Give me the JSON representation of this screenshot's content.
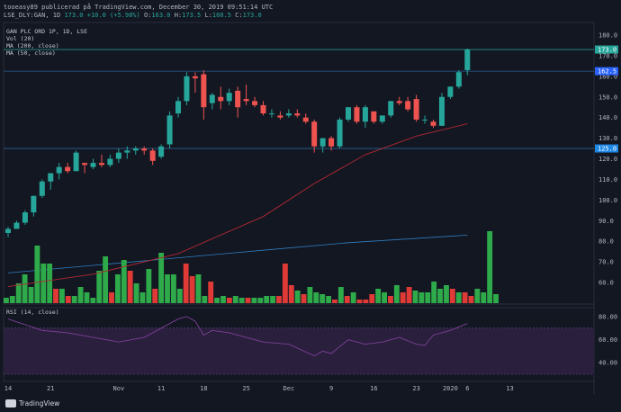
{
  "header": {
    "line1": "tooeasy89 publicerad på TradingView.com, December 30, 2019 09:51:14 UTC",
    "symbol": "LSE_DLY:GAN, 1D",
    "last": "173.0",
    "change": "+10.0 (+5.98%)",
    "o": "O:",
    "o_val": "163.0",
    "h": "H:",
    "h_val": "173.5",
    "l": "L:",
    "l_val": "160.5",
    "c": "C:",
    "c_val": "173.0"
  },
  "legend": {
    "title": "GAN PLC ORD 1P, 1D, LSE",
    "vol": "Vol (20)",
    "ma200": "MA (200, close)",
    "ma50": "MA (50, close)"
  },
  "rsi_label": "RSI (14, close)",
  "brand": "TradingView",
  "colors": {
    "bg": "#131722",
    "up": "#26a69a",
    "down": "#ef5350",
    "vol_up": "#2eaa4a",
    "vol_down": "#e03a36",
    "ma50": "#b22833",
    "ma200": "#2f7dc0",
    "rsi": "#7e3f98",
    "rsi_band": "#2a1f3d",
    "label_green": "#26a69a",
    "label_blue": "#2962ff",
    "label_blue2": "#1e88e5"
  },
  "chart_data": {
    "type": "candlestick",
    "y_ticks": [
      "180.0",
      "170.0",
      "160.0",
      "150.0",
      "140.0",
      "130.0",
      "120.0",
      "110.0",
      "100.0",
      "90.0",
      "80.0",
      "70.0",
      "60.0"
    ],
    "price_labels": [
      {
        "text": "173.0",
        "value": 173.0,
        "color": "green"
      },
      {
        "text": "162.5",
        "value": 162.5,
        "color": "blue"
      },
      {
        "text": "125.0",
        "value": 125.0,
        "color": "blue2"
      }
    ],
    "price_lines": [
      173.0,
      162.5,
      125.0
    ],
    "rsi_ticks": [
      "80.00",
      "60.00",
      "40.00"
    ],
    "rsi_band": [
      30,
      70
    ],
    "x_ticks": [
      {
        "label": "14",
        "idx": 0
      },
      {
        "label": "21",
        "idx": 5
      },
      {
        "label": "Nov",
        "idx": 13
      },
      {
        "label": "11",
        "idx": 18
      },
      {
        "label": "18",
        "idx": 23
      },
      {
        "label": "25",
        "idx": 28
      },
      {
        "label": "Dec",
        "idx": 33
      },
      {
        "label": "9",
        "idx": 38
      },
      {
        "label": "16",
        "idx": 43
      },
      {
        "label": "23",
        "idx": 48
      },
      {
        "label": "2020",
        "idx": 52
      },
      {
        "label": "6",
        "idx": 54
      },
      {
        "label": "13",
        "idx": 59
      }
    ],
    "candles": [
      {
        "o": 84,
        "h": 87,
        "l": 82,
        "c": 86
      },
      {
        "o": 86,
        "h": 90,
        "l": 86,
        "c": 89
      },
      {
        "o": 89,
        "h": 95,
        "l": 88,
        "c": 94
      },
      {
        "o": 94,
        "h": 102,
        "l": 92,
        "c": 102
      },
      {
        "o": 102,
        "h": 110,
        "l": 101,
        "c": 109
      },
      {
        "o": 109,
        "h": 113,
        "l": 105,
        "c": 113
      },
      {
        "o": 113,
        "h": 118,
        "l": 110,
        "c": 116
      },
      {
        "o": 116,
        "h": 118,
        "l": 113,
        "c": 114
      },
      {
        "o": 114,
        "h": 124,
        "l": 114,
        "c": 123
      },
      {
        "o": 118,
        "h": 118,
        "l": 113,
        "c": 117
      },
      {
        "o": 116,
        "h": 120,
        "l": 115,
        "c": 118
      },
      {
        "o": 118,
        "h": 122,
        "l": 116,
        "c": 117
      },
      {
        "o": 117,
        "h": 122,
        "l": 116,
        "c": 120
      },
      {
        "o": 120,
        "h": 125,
        "l": 118,
        "c": 123
      },
      {
        "o": 123,
        "h": 126,
        "l": 120,
        "c": 124
      },
      {
        "o": 124,
        "h": 126,
        "l": 122,
        "c": 125
      },
      {
        "o": 125,
        "h": 126,
        "l": 122,
        "c": 124
      },
      {
        "o": 124,
        "h": 125,
        "l": 117,
        "c": 119
      },
      {
        "o": 121,
        "h": 127,
        "l": 120,
        "c": 126
      },
      {
        "o": 127,
        "h": 143,
        "l": 125,
        "c": 141
      },
      {
        "o": 142,
        "h": 150,
        "l": 140,
        "c": 148
      },
      {
        "o": 148,
        "h": 162,
        "l": 146,
        "c": 160
      },
      {
        "o": 160,
        "h": 162,
        "l": 152,
        "c": 159
      },
      {
        "o": 161,
        "h": 163,
        "l": 139,
        "c": 145
      },
      {
        "o": 147,
        "h": 152,
        "l": 144,
        "c": 151
      },
      {
        "o": 150,
        "h": 155,
        "l": 144,
        "c": 148
      },
      {
        "o": 148,
        "h": 154,
        "l": 146,
        "c": 152
      },
      {
        "o": 153,
        "h": 155,
        "l": 140,
        "c": 145
      },
      {
        "o": 149,
        "h": 156,
        "l": 146,
        "c": 148
      },
      {
        "o": 148,
        "h": 150,
        "l": 145,
        "c": 146
      },
      {
        "o": 146,
        "h": 148,
        "l": 141,
        "c": 142
      },
      {
        "o": 142,
        "h": 144,
        "l": 140,
        "c": 142
      },
      {
        "o": 141,
        "h": 143,
        "l": 139,
        "c": 140
      },
      {
        "o": 141,
        "h": 144,
        "l": 140,
        "c": 142
      },
      {
        "o": 142,
        "h": 144,
        "l": 140,
        "c": 141
      },
      {
        "o": 140,
        "h": 142,
        "l": 137,
        "c": 138
      },
      {
        "o": 138,
        "h": 139,
        "l": 123,
        "c": 126
      },
      {
        "o": 126,
        "h": 130,
        "l": 123,
        "c": 130
      },
      {
        "o": 130,
        "h": 131,
        "l": 124,
        "c": 126
      },
      {
        "o": 126,
        "h": 140,
        "l": 125,
        "c": 139
      },
      {
        "o": 139,
        "h": 145,
        "l": 138,
        "c": 145
      },
      {
        "o": 145,
        "h": 146,
        "l": 137,
        "c": 138
      },
      {
        "o": 138,
        "h": 146,
        "l": 135,
        "c": 145
      },
      {
        "o": 143,
        "h": 143,
        "l": 137,
        "c": 138
      },
      {
        "o": 138,
        "h": 141,
        "l": 137,
        "c": 141
      },
      {
        "o": 141,
        "h": 148,
        "l": 140,
        "c": 148
      },
      {
        "o": 148,
        "h": 150,
        "l": 146,
        "c": 147
      },
      {
        "o": 148,
        "h": 150,
        "l": 143,
        "c": 144
      },
      {
        "o": 149,
        "h": 151,
        "l": 138,
        "c": 139
      },
      {
        "o": 139,
        "h": 141,
        "l": 137,
        "c": 139
      },
      {
        "o": 138,
        "h": 139,
        "l": 135,
        "c": 136
      },
      {
        "o": 136,
        "h": 152,
        "l": 136,
        "c": 150
      },
      {
        "o": 150,
        "h": 155,
        "l": 149,
        "c": 155
      },
      {
        "o": 155,
        "h": 163,
        "l": 154,
        "c": 162
      },
      {
        "o": 163,
        "h": 173.5,
        "l": 160.5,
        "c": 173
      }
    ],
    "volumes": [
      {
        "v": 0.15,
        "up": true
      },
      {
        "v": 0.2,
        "up": true
      },
      {
        "v": 0.55,
        "up": true
      },
      {
        "v": 0.8,
        "up": true
      },
      {
        "v": 0.45,
        "up": true
      },
      {
        "v": 1.6,
        "up": true
      },
      {
        "v": 1.1,
        "up": true
      },
      {
        "v": 1.1,
        "up": true
      },
      {
        "v": 0.4,
        "up": false
      },
      {
        "v": 0.4,
        "up": true
      },
      {
        "v": 0.2,
        "up": false
      },
      {
        "v": 0.2,
        "up": true
      },
      {
        "v": 0.45,
        "up": true
      },
      {
        "v": 0.3,
        "up": true
      },
      {
        "v": 0.15,
        "up": true
      },
      {
        "v": 0.9,
        "up": true
      },
      {
        "v": 1.3,
        "up": true
      },
      {
        "v": 0.3,
        "up": false
      },
      {
        "v": 0.8,
        "up": true
      },
      {
        "v": 1.2,
        "up": true
      },
      {
        "v": 0.9,
        "up": false
      },
      {
        "v": 0.55,
        "up": true
      },
      {
        "v": 0.3,
        "up": true
      },
      {
        "v": 0.95,
        "up": true
      },
      {
        "v": 0.4,
        "up": false
      },
      {
        "v": 1.4,
        "up": true
      },
      {
        "v": 0.8,
        "up": true
      },
      {
        "v": 0.8,
        "up": true
      },
      {
        "v": 0.4,
        "up": true
      },
      {
        "v": 1.1,
        "up": false
      },
      {
        "v": 0.75,
        "up": false
      },
      {
        "v": 0.8,
        "up": true
      },
      {
        "v": 0.2,
        "up": true
      },
      {
        "v": 0.6,
        "up": false
      },
      {
        "v": 0.15,
        "up": true
      },
      {
        "v": 0.2,
        "up": true
      },
      {
        "v": 0.15,
        "up": false
      },
      {
        "v": 0.2,
        "up": true
      },
      {
        "v": 0.15,
        "up": true
      },
      {
        "v": 0.15,
        "up": false
      },
      {
        "v": 0.15,
        "up": true
      },
      {
        "v": 0.15,
        "up": true
      },
      {
        "v": 0.2,
        "up": true
      },
      {
        "v": 0.2,
        "up": true
      },
      {
        "v": 0.2,
        "up": false
      },
      {
        "v": 1.1,
        "up": false
      },
      {
        "v": 0.5,
        "up": false
      },
      {
        "v": 0.35,
        "up": true
      },
      {
        "v": 0.25,
        "up": false
      },
      {
        "v": 0.45,
        "up": true
      },
      {
        "v": 0.3,
        "up": true
      },
      {
        "v": 0.25,
        "up": true
      },
      {
        "v": 0.2,
        "up": true
      },
      {
        "v": 0.1,
        "up": false
      },
      {
        "v": 0.45,
        "up": true
      },
      {
        "v": 0.2,
        "up": false
      },
      {
        "v": 0.3,
        "up": true
      },
      {
        "v": 0.1,
        "up": false
      },
      {
        "v": 0.1,
        "up": false
      },
      {
        "v": 0.25,
        "up": false
      },
      {
        "v": 0.4,
        "up": true
      },
      {
        "v": 0.3,
        "up": true
      },
      {
        "v": 0.2,
        "up": false
      },
      {
        "v": 0.5,
        "up": true
      },
      {
        "v": 0.3,
        "up": false
      },
      {
        "v": 0.45,
        "up": false
      },
      {
        "v": 0.35,
        "up": true
      },
      {
        "v": 0.3,
        "up": true
      },
      {
        "v": 0.3,
        "up": true
      },
      {
        "v": 0.6,
        "up": true
      },
      {
        "v": 0.4,
        "up": true
      },
      {
        "v": 0.5,
        "up": true
      },
      {
        "v": 0.4,
        "up": false
      },
      {
        "v": 0.3,
        "up": true
      },
      {
        "v": 0.3,
        "up": false
      },
      {
        "v": 0.2,
        "up": false
      },
      {
        "v": 0.4,
        "up": true
      },
      {
        "v": 0.3,
        "up": true
      },
      {
        "v": 2.0,
        "up": true
      },
      {
        "v": 0.25,
        "up": true
      }
    ],
    "ma50": [
      {
        "i": 0,
        "v": 58
      },
      {
        "i": 10,
        "v": 64
      },
      {
        "i": 20,
        "v": 74
      },
      {
        "i": 30,
        "v": 92
      },
      {
        "i": 36,
        "v": 108
      },
      {
        "i": 42,
        "v": 122
      },
      {
        "i": 48,
        "v": 131
      },
      {
        "i": 54,
        "v": 137
      }
    ],
    "ma200_vol": [
      {
        "i": 0,
        "v": 0.6
      },
      {
        "i": 10,
        "v": 0.75
      },
      {
        "i": 20,
        "v": 0.9
      },
      {
        "i": 30,
        "v": 1.05
      },
      {
        "i": 40,
        "v": 1.2
      },
      {
        "i": 54,
        "v": 1.35
      }
    ],
    "rsi": [
      {
        "i": 0,
        "v": 78
      },
      {
        "i": 4,
        "v": 68
      },
      {
        "i": 7,
        "v": 66
      },
      {
        "i": 10,
        "v": 62
      },
      {
        "i": 13,
        "v": 58
      },
      {
        "i": 16,
        "v": 62
      },
      {
        "i": 18,
        "v": 70
      },
      {
        "i": 20,
        "v": 78
      },
      {
        "i": 21,
        "v": 80
      },
      {
        "i": 22,
        "v": 76
      },
      {
        "i": 23,
        "v": 64
      },
      {
        "i": 24,
        "v": 68
      },
      {
        "i": 26,
        "v": 66
      },
      {
        "i": 28,
        "v": 62
      },
      {
        "i": 30,
        "v": 58
      },
      {
        "i": 33,
        "v": 56
      },
      {
        "i": 36,
        "v": 46
      },
      {
        "i": 37,
        "v": 50
      },
      {
        "i": 38,
        "v": 48
      },
      {
        "i": 40,
        "v": 60
      },
      {
        "i": 42,
        "v": 56
      },
      {
        "i": 44,
        "v": 58
      },
      {
        "i": 46,
        "v": 62
      },
      {
        "i": 48,
        "v": 56
      },
      {
        "i": 49,
        "v": 55
      },
      {
        "i": 50,
        "v": 64
      },
      {
        "i": 52,
        "v": 68
      },
      {
        "i": 54,
        "v": 74
      }
    ]
  }
}
